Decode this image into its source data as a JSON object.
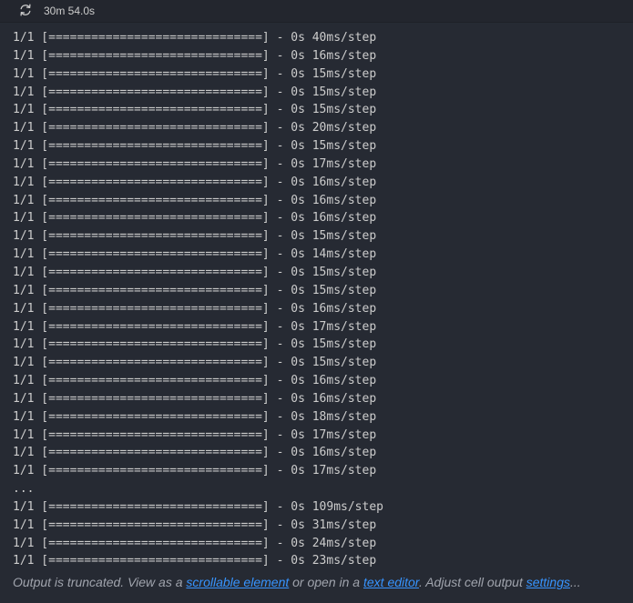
{
  "status": {
    "refresh_icon": "refresh-icon",
    "execution_time": "30m 54.0s"
  },
  "output": {
    "lines": [
      "1/1 [==============================] - 0s 40ms/step",
      "1/1 [==============================] - 0s 16ms/step",
      "1/1 [==============================] - 0s 15ms/step",
      "1/1 [==============================] - 0s 15ms/step",
      "1/1 [==============================] - 0s 15ms/step",
      "1/1 [==============================] - 0s 20ms/step",
      "1/1 [==============================] - 0s 15ms/step",
      "1/1 [==============================] - 0s 17ms/step",
      "1/1 [==============================] - 0s 16ms/step",
      "1/1 [==============================] - 0s 16ms/step",
      "1/1 [==============================] - 0s 16ms/step",
      "1/1 [==============================] - 0s 15ms/step",
      "1/1 [==============================] - 0s 14ms/step",
      "1/1 [==============================] - 0s 15ms/step",
      "1/1 [==============================] - 0s 15ms/step",
      "1/1 [==============================] - 0s 16ms/step",
      "1/1 [==============================] - 0s 17ms/step",
      "1/1 [==============================] - 0s 15ms/step",
      "1/1 [==============================] - 0s 15ms/step",
      "1/1 [==============================] - 0s 16ms/step",
      "1/1 [==============================] - 0s 16ms/step",
      "1/1 [==============================] - 0s 18ms/step",
      "1/1 [==============================] - 0s 17ms/step",
      "1/1 [==============================] - 0s 16ms/step",
      "1/1 [==============================] - 0s 17ms/step",
      "...",
      "1/1 [==============================] - 0s 109ms/step",
      "1/1 [==============================] - 0s 31ms/step",
      "1/1 [==============================] - 0s 24ms/step",
      "1/1 [==============================] - 0s 23ms/step"
    ]
  },
  "footer": {
    "text_1": "Output is truncated. View as a ",
    "link_scrollable": "scrollable element",
    "text_2": " or open in a ",
    "link_editor": "text editor",
    "text_3": ". Adjust cell output ",
    "link_settings": "settings",
    "text_4": "...",
    "link_color": "#3794ff"
  }
}
